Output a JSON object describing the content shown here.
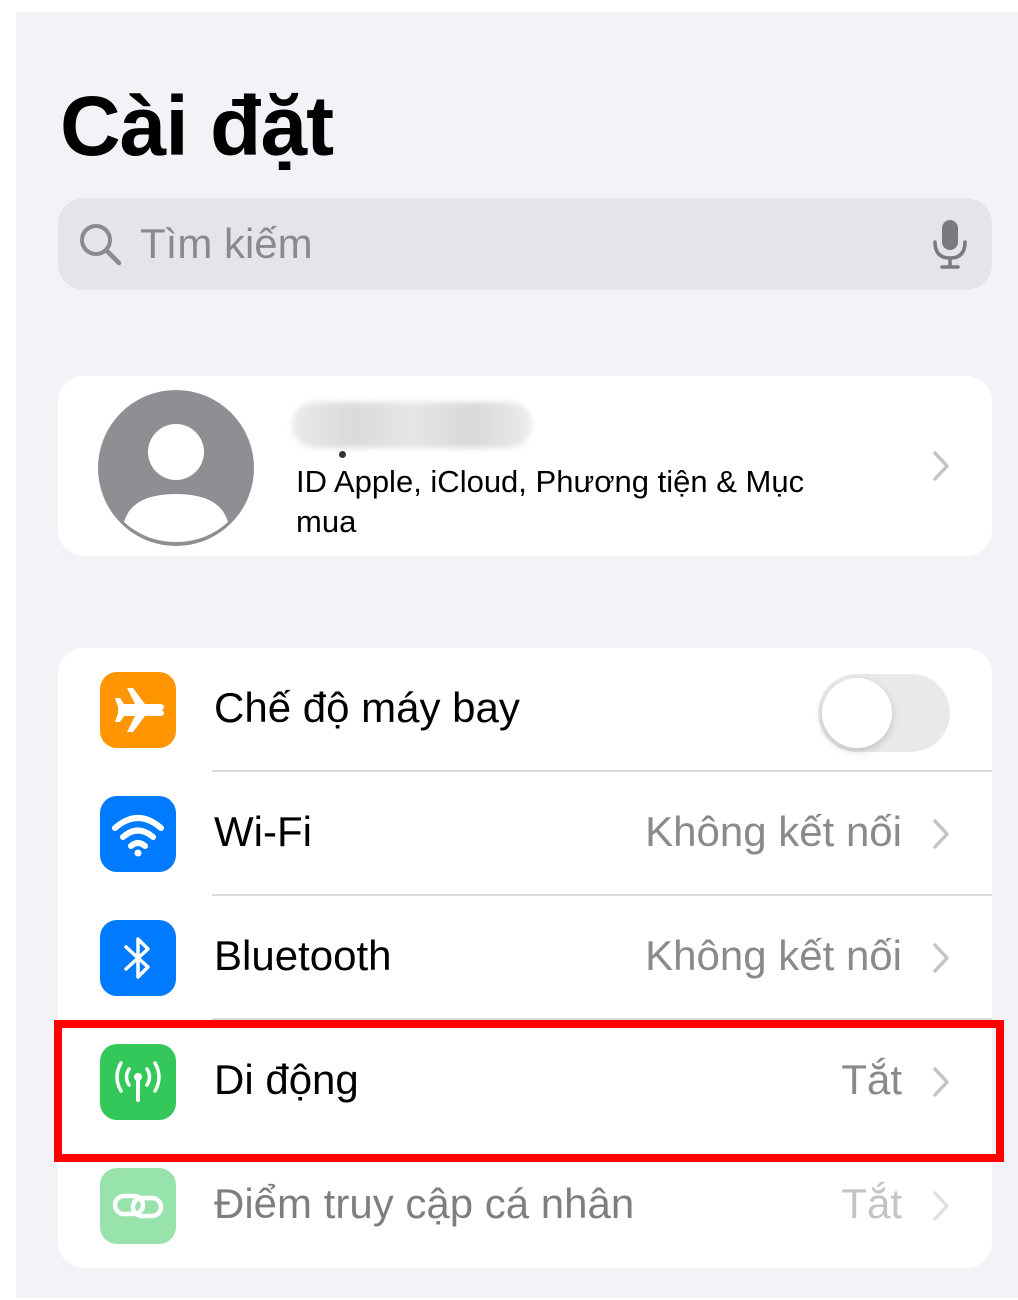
{
  "page": {
    "title": "Cài đặt"
  },
  "search": {
    "placeholder": "Tìm kiếm",
    "search_icon": "magnifying-glass",
    "mic_icon": "microphone"
  },
  "profile": {
    "subtitle": "ID Apple, iCloud, Phương tiện & Mục mua",
    "avatar_icon": "person-silhouette",
    "name_state": "blurred"
  },
  "settings": {
    "items": [
      {
        "label": "Chế độ máy bay",
        "icon": "airplane-icon",
        "icon_color": "#ff9500",
        "control": "toggle",
        "toggle_on": false
      },
      {
        "label": "Wi-Fi",
        "value": "Không kết nối",
        "icon": "wifi-icon",
        "icon_color": "#007aff"
      },
      {
        "label": "Bluetooth",
        "value": "Không kết nối",
        "icon": "bluetooth-icon",
        "icon_color": "#007aff"
      },
      {
        "label": "Di động",
        "value": "Tắt",
        "icon": "cellular-antenna-icon",
        "icon_color": "#34c759",
        "highlighted": true
      },
      {
        "label": "Điểm truy cập cá nhân",
        "value": "Tắt",
        "icon": "hotspot-link-icon",
        "icon_color": "#34c759",
        "disabled": true
      }
    ]
  },
  "colors": {
    "background": "#f2f2f7",
    "card": "#ffffff",
    "highlight": "#ff0000",
    "secondary_text": "#8a8a8e"
  }
}
